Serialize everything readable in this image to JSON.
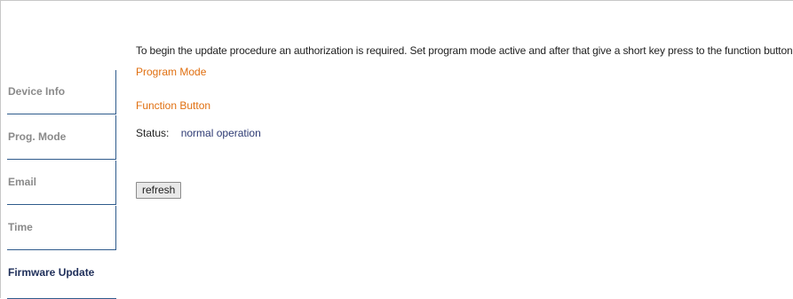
{
  "sidebar": {
    "items": [
      {
        "label": "Device Info"
      },
      {
        "label": "Prog. Mode"
      },
      {
        "label": "Email"
      },
      {
        "label": "Time"
      },
      {
        "label": "Firmware Update"
      }
    ],
    "active_index": 4
  },
  "main": {
    "intro_text": "To begin the update procedure an authorization is required. Set program mode active and after that give a short key press to the function button",
    "program_mode_label": "Program Mode",
    "function_button_label": "Function Button",
    "status_label": "Status:",
    "status_value": "normal operation",
    "refresh_label": "refresh"
  },
  "colors": {
    "accent_orange": "#e06f10",
    "nav_border": "#2f5b8c",
    "status_value": "#2d3a73",
    "nav_inactive_text": "#8a8a8a",
    "nav_active_text": "#1f2f5a"
  }
}
